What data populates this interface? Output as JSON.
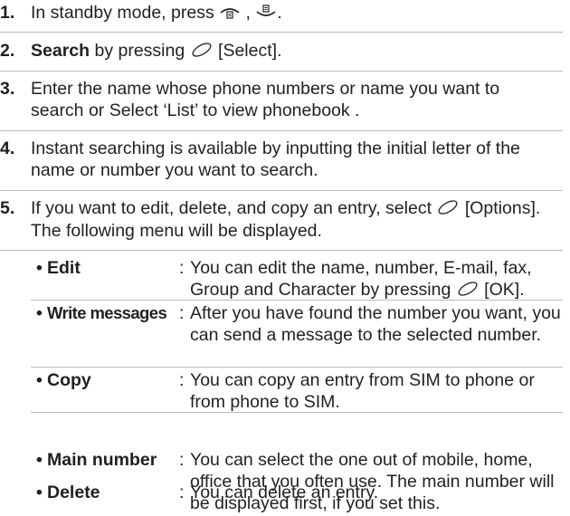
{
  "steps": [
    {
      "number": "1.",
      "text_pre": "In standby mode, press",
      "text_mid": ",",
      "text_post": "."
    },
    {
      "number": "2.",
      "bold": "Search",
      "text_pre": "by pressing",
      "text_post": "[Select]."
    },
    {
      "number": "3.",
      "text": "Enter the name whose phone numbers or name you want to search or Select ‘List’ to view phonebook ."
    },
    {
      "number": "4.",
      "text": "Instant searching is available by inputting the initial letter of the name or number you want to search."
    },
    {
      "number": "5.",
      "text_pre": "If you want to edit, delete, and copy an entry, select",
      "text_post": "[Options]. The following menu will be displayed."
    }
  ],
  "options": [
    {
      "label": "Edit",
      "desc_pre": "You can edit the name, number, E-mail, fax, Group and Character by pressing",
      "desc_post": "[OK]."
    },
    {
      "label": "Write messages",
      "desc": "After you have found the number you want, you can send a message to the selected number."
    },
    {
      "label": "Copy",
      "desc": "You can copy an entry from SIM to phone or from phone to SIM."
    },
    {
      "label": "Main number",
      "desc": "You can select the one out of mobile, home, office that you often use. The main number will be displayed first, if you set this."
    },
    {
      "label": "Delete",
      "desc": "You can delete an entry."
    }
  ],
  "bullet": "•",
  "colon": ":",
  "icons": {
    "menu_key": "phonebook-up-key-icon",
    "down_key": "phonebook-down-key-icon",
    "select_key": "soft-key-icon"
  }
}
